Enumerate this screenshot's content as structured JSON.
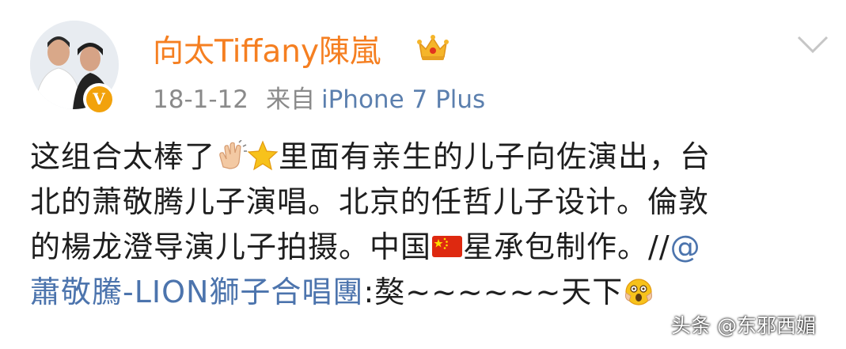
{
  "post": {
    "author": {
      "name": "向太Tiffany陳嵐",
      "badge_icon": "crown-icon",
      "verified_icon": "verified-v-icon",
      "verified_letter": "V"
    },
    "meta": {
      "date": "18-1-12",
      "source_prefix": "来自",
      "device": "iPhone 7 Plus"
    },
    "content": {
      "line1_a": "这组合太棒了",
      "line1_b": "里面有亲生的儿子向佐演出，台",
      "line2": "北的萧敬腾儿子演唱。北京的任哲儿子设计。倫敦",
      "line3_a": "的楊龙澄导演儿子拍摄。中国",
      "line3_b": "星承包制作。//",
      "line3_c": "@",
      "line4_mention": "蕭敬騰-LION獅子合唱團",
      "line4_text": ":獒~~~~~~天下"
    },
    "icons": [
      "clap-emoji",
      "star-emoji",
      "china-flag-emoji",
      "scared-face-emoji",
      "chevron-down-icon"
    ],
    "colors": {
      "username": "#f57f21",
      "mention": "#4c74ad",
      "device": "#5b7fae",
      "meta": "#8a8a8a"
    }
  },
  "watermark": "头条 @东邪西媚"
}
